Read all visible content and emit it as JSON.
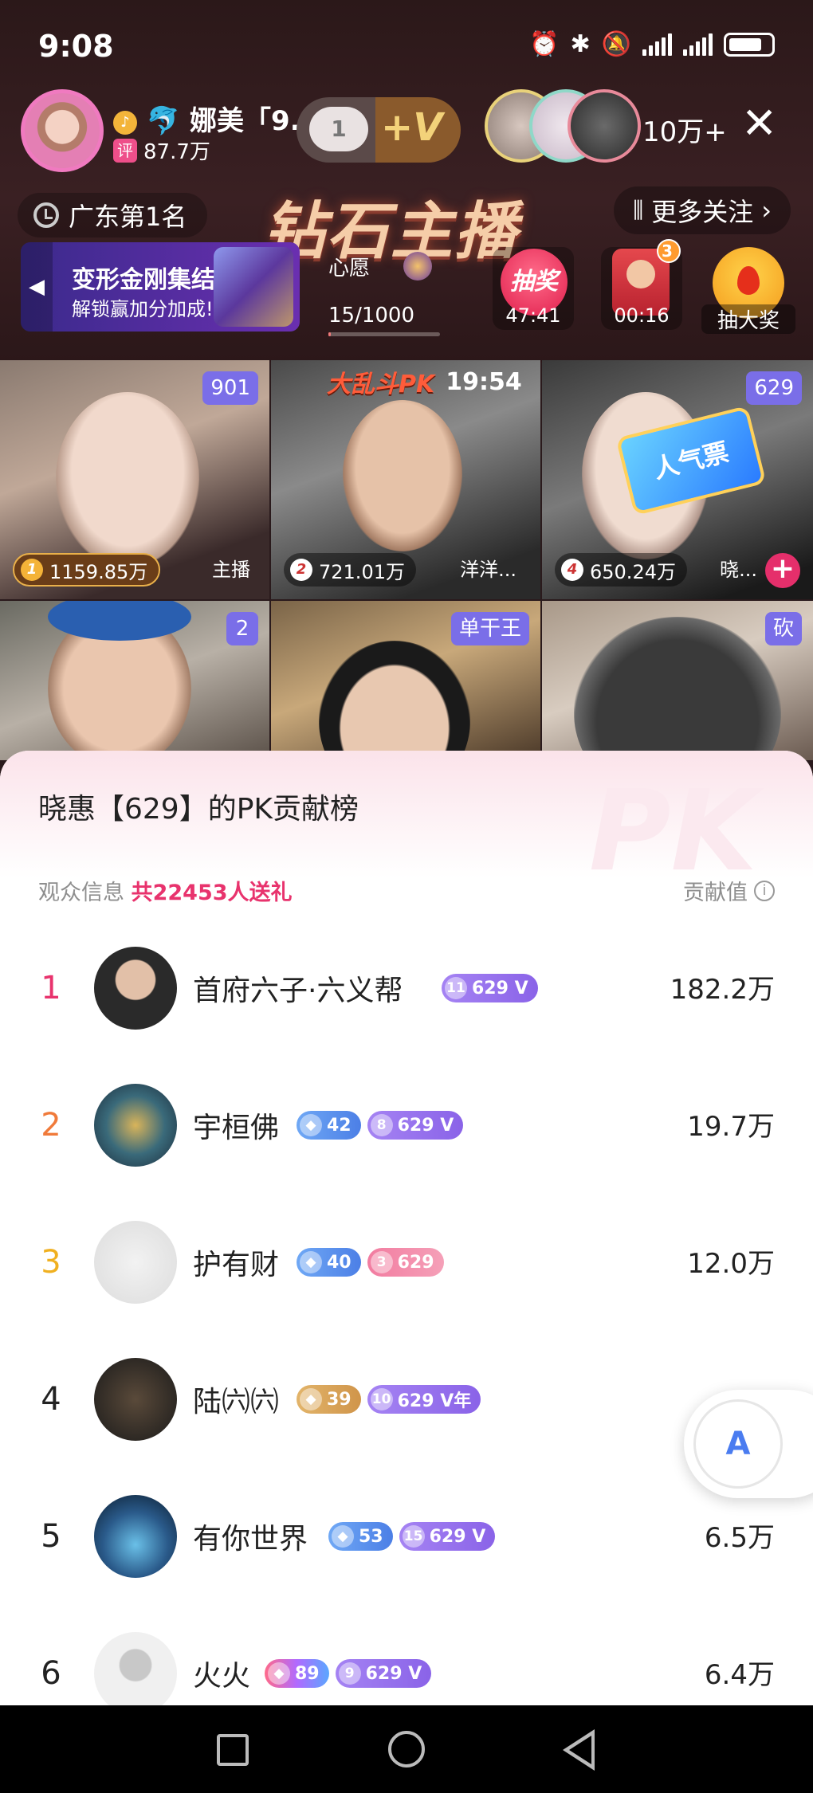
{
  "status": {
    "time": "9:08"
  },
  "host": {
    "name": "娜美「9...",
    "fans": "87.7万",
    "ping": "评"
  },
  "follow": {
    "heart": "1",
    "plus": "+V"
  },
  "audience": {
    "count": "10万+"
  },
  "rank": {
    "label": "广东第1名"
  },
  "title_banner": "钻石主播",
  "more_follow": "更多关注",
  "promo": {
    "title": "变形金刚集结",
    "subtitle": "解锁赢加分加成!"
  },
  "wish": {
    "label": "心愿",
    "progress_text": "15/1000",
    "progress": 0.015
  },
  "gifts": {
    "lottery": {
      "label": "抽奖",
      "timer": "47:41"
    },
    "redbag": {
      "badge": "3",
      "timer": "00:16"
    },
    "bigdraw": {
      "label": "抽大奖"
    }
  },
  "pk": {
    "logo": "大乱斗PK",
    "timer": "19:54"
  },
  "tiles": [
    {
      "badge": "901",
      "rank": "1",
      "score": "1159.85万",
      "name": "主播"
    },
    {
      "badge": "",
      "rank": "2",
      "score": "721.01万",
      "name": "洋洋..."
    },
    {
      "badge": "629",
      "rank": "4",
      "score": "650.24万",
      "name": "晓...",
      "popcard": "人气票"
    },
    {
      "badge": "2"
    },
    {
      "badge": "单干王"
    },
    {
      "badge": "砍"
    }
  ],
  "sheet": {
    "title": "晓惠【629】的PK贡献榜",
    "audience_label": "观众信息",
    "audience_count": "共22453人送礼",
    "contrib_label": "贡献值",
    "watermark": "PK"
  },
  "leaderboard": [
    {
      "rank": "1",
      "name": "首府六子·六义帮",
      "badges": [
        {
          "style": "purple",
          "icon": "11",
          "text": "629 V"
        }
      ],
      "value": "182.2万",
      "rank_color": "#e8336d"
    },
    {
      "rank": "2",
      "name": "宇桓佛",
      "badges": [
        {
          "style": "blue",
          "icon": "◆",
          "text": "42"
        },
        {
          "style": "purple",
          "icon": "8",
          "text": "629 V"
        }
      ],
      "value": "19.7万",
      "rank_color": "#f07a3a"
    },
    {
      "rank": "3",
      "name": "护有财",
      "badges": [
        {
          "style": "blue",
          "icon": "◆",
          "text": "40"
        },
        {
          "style": "pink",
          "icon": "3",
          "text": "629"
        }
      ],
      "value": "12.0万",
      "rank_color": "#f0b020"
    },
    {
      "rank": "4",
      "name": "陆㈥㈥",
      "badges": [
        {
          "style": "gold",
          "icon": "◆",
          "text": "39"
        },
        {
          "style": "purple",
          "icon": "10",
          "text": "629 V年"
        }
      ],
      "value": "",
      "rank_color": "#222"
    },
    {
      "rank": "5",
      "name": "有你世界",
      "badges": [
        {
          "style": "blue",
          "icon": "◆",
          "text": "53"
        },
        {
          "style": "purple",
          "icon": "15",
          "text": "629 V"
        }
      ],
      "value": "6.5万",
      "rank_color": "#222"
    },
    {
      "rank": "6",
      "name": "火火",
      "badges": [
        {
          "style": "rainbow",
          "icon": "◆",
          "text": "89"
        },
        {
          "style": "purple",
          "icon": "9",
          "text": "629 V"
        }
      ],
      "value": "6.4万",
      "rank_color": "#222"
    }
  ],
  "float_button": {
    "label": "A"
  }
}
